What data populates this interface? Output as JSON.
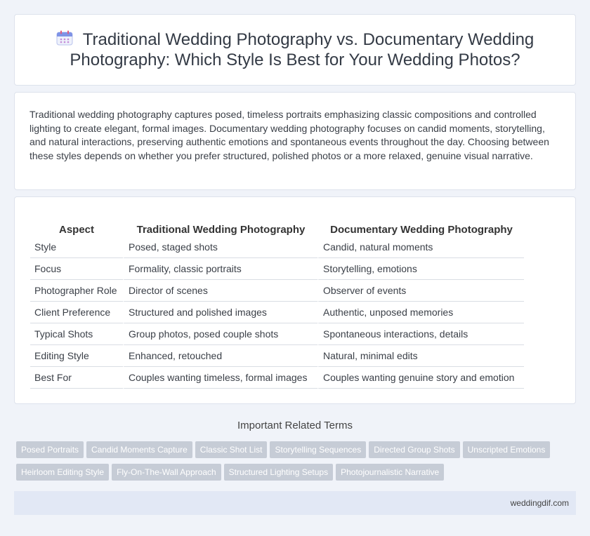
{
  "header": {
    "icon": "calendar-icon",
    "title": "Traditional Wedding Photography vs. Documentary Wedding Photography: Which Style Is Best for Your Wedding Photos?"
  },
  "intro": {
    "text": "Traditional wedding photography captures posed, timeless portraits emphasizing classic compositions and controlled lighting to create elegant, formal images. Documentary wedding photography focuses on candid moments, storytelling, and natural interactions, preserving authentic emotions and spontaneous events throughout the day. Choosing between these styles depends on whether you prefer structured, polished photos or a more relaxed, genuine visual narrative."
  },
  "comparison": {
    "headers": [
      "Aspect",
      "Traditional Wedding Photography",
      "Documentary Wedding Photography"
    ],
    "rows": [
      [
        "Style",
        "Posed, staged shots",
        "Candid, natural moments"
      ],
      [
        "Focus",
        "Formality, classic portraits",
        "Storytelling, emotions"
      ],
      [
        "Photographer Role",
        "Director of scenes",
        "Observer of events"
      ],
      [
        "Client Preference",
        "Structured and polished images",
        "Authentic, unposed memories"
      ],
      [
        "Typical Shots",
        "Group photos, posed couple shots",
        "Spontaneous interactions, details"
      ],
      [
        "Editing Style",
        "Enhanced, retouched",
        "Natural, minimal edits"
      ],
      [
        "Best For",
        "Couples wanting timeless, formal images",
        "Couples wanting genuine story and emotion"
      ]
    ]
  },
  "related": {
    "title": "Important Related Terms",
    "tags": [
      "Posed Portraits",
      "Candid Moments Capture",
      "Classic Shot List",
      "Storytelling Sequences",
      "Directed Group Shots",
      "Unscripted Emotions",
      "Heirloom Editing Style",
      "Fly-On-The-Wall Approach",
      "Structured Lighting Setups",
      "Photojournalistic Narrative"
    ]
  },
  "footer": {
    "site": "weddingdif.com"
  },
  "colors": {
    "background": "#f0f3f9",
    "tag": "#c6ccd6",
    "footer": "#e2e8f5"
  }
}
